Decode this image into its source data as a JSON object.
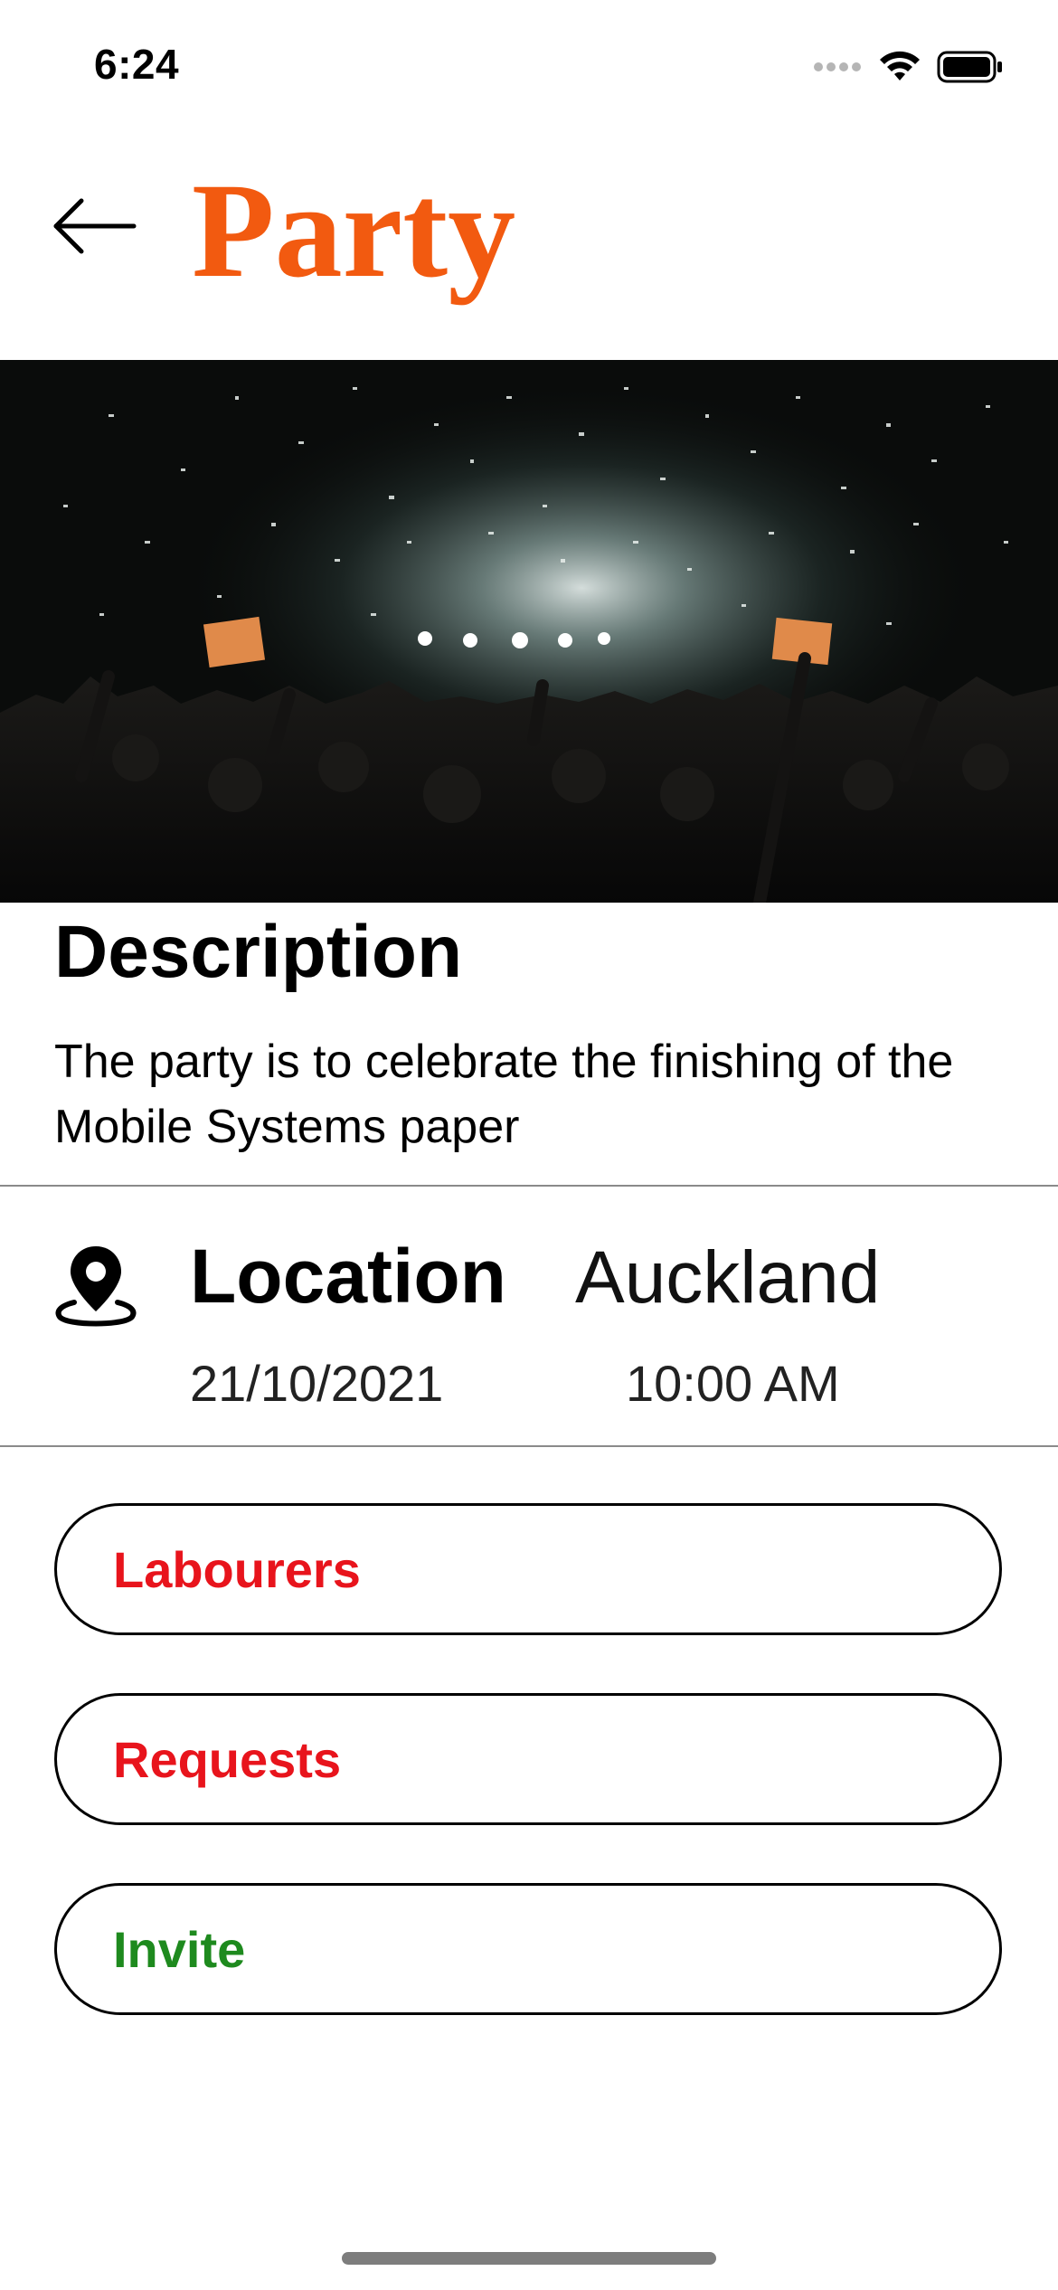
{
  "status_bar": {
    "time": "6:24",
    "icons": [
      "signal-dots-icon",
      "wifi-icon",
      "battery-icon"
    ]
  },
  "header": {
    "back_icon": "arrow-left-icon",
    "title": "Party",
    "title_color": "#f25a10"
  },
  "hero": {
    "image_subject": "concert-crowd-confetti-photo"
  },
  "description": {
    "heading": "Description",
    "text": "The party is to celebrate the finishing of the Mobile Systems paper"
  },
  "location": {
    "icon": "map-pin-icon",
    "label": "Location",
    "value": "Auckland",
    "date": "21/10/2021",
    "time": "10:00 AM"
  },
  "actions": [
    {
      "label": "Labourers",
      "color": "#e8141c"
    },
    {
      "label": "Requests",
      "color": "#e8141c"
    },
    {
      "label": "Invite",
      "color": "#1e8a1e"
    }
  ]
}
